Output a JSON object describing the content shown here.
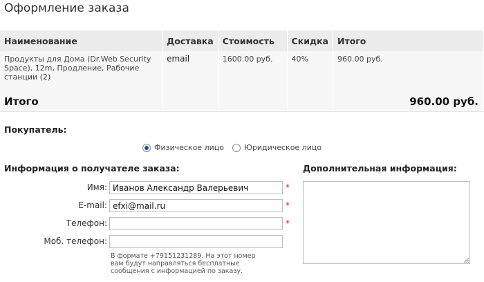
{
  "page": {
    "title": "Оформление заказа"
  },
  "order_table": {
    "headers": [
      "Наименование",
      "Доставка",
      "Стоимость",
      "Скидка",
      "Итого"
    ],
    "rows": [
      {
        "name": "Продукты для Дома (Dr.Web Security Space), 12m, Продление, Рабочие станции (2)",
        "delivery": "email",
        "price": "1600.00 руб.",
        "discount": "40%",
        "total": "960.00 руб."
      }
    ]
  },
  "summary": {
    "label": "Итого",
    "value": "960.00 руб."
  },
  "buyer": {
    "label": "Покупатель:",
    "options": [
      "Физическое лицо",
      "Юридическое лицо"
    ],
    "selected": "Физическое лицо"
  },
  "recipient": {
    "section_title": "Информация о получателе заказа:",
    "fields": [
      {
        "label": "Имя:",
        "value": "Иванов Александр Валерьевич",
        "required": true
      },
      {
        "label": "E-mail:",
        "value": "efxi@mail.ru",
        "required": true
      },
      {
        "label": "Телефон:",
        "value": "",
        "required": true
      },
      {
        "label": "Моб. телефон:",
        "value": "",
        "required": false
      }
    ],
    "required_mark": "*",
    "mobile_hint": "В формате +79151231289. На этот номер вам будут направляться бесплатные сообщения с информацией по заказу."
  },
  "additional": {
    "section_title": "Дополнительная информация:",
    "value": ""
  },
  "colors": {
    "header_bg": "#ececec",
    "row_bg": "#f7f7f7",
    "required": "#cc2222",
    "radio_dot": "#1e4f9a"
  }
}
